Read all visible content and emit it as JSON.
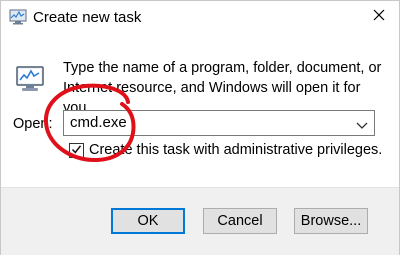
{
  "window": {
    "title": "Create new task"
  },
  "icons": {
    "title_icon": "task-manager-icon",
    "close_icon": "close-icon",
    "program_icon": "task-manager-monitor-icon",
    "dropdown_icon": "chevron-down-icon",
    "check_icon": "checkmark-icon"
  },
  "dialog": {
    "description": "Type the name of a program, folder, document, or Internet resource, and Windows will open it for you.",
    "open_label": "Open:",
    "open_value": "cmd.exe",
    "admin_checkbox_label": "Create this task with administrative privileges.",
    "admin_checked": true
  },
  "buttons": {
    "ok": "OK",
    "cancel": "Cancel",
    "browse": "Browse..."
  },
  "colors": {
    "annotation_circle": "#e0101a",
    "default_button_border": "#0078d7"
  }
}
